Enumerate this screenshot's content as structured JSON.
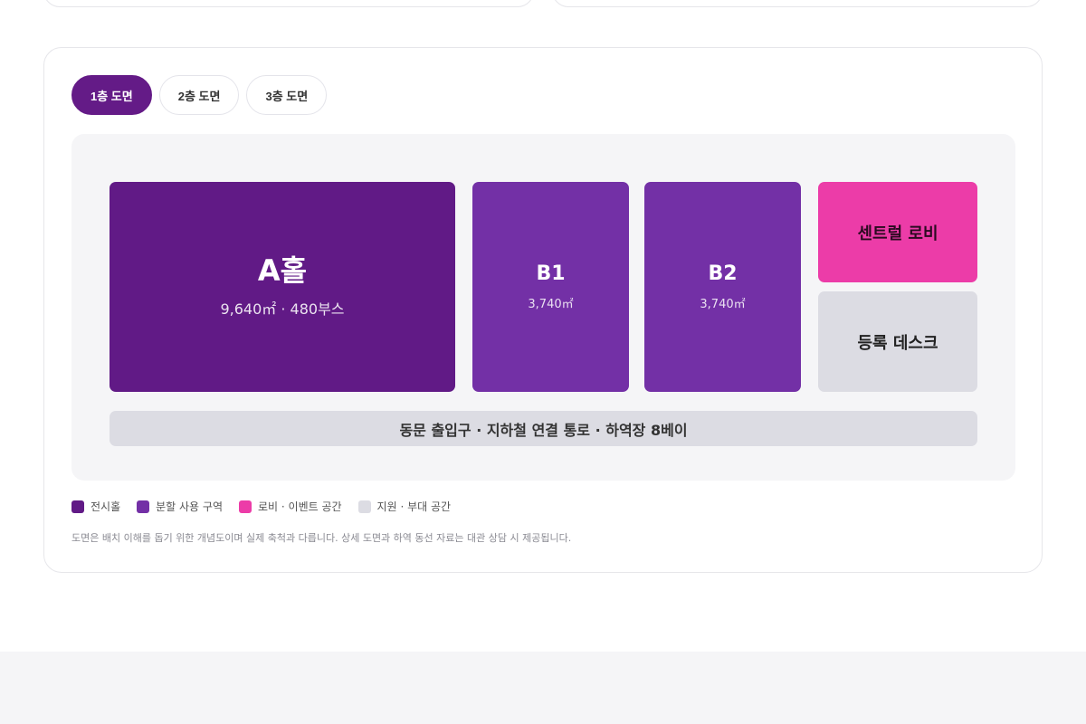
{
  "tabs": [
    {
      "label": "1층 도면",
      "active": true
    },
    {
      "label": "2층 도면",
      "active": false
    },
    {
      "label": "3층 도면",
      "active": false
    }
  ],
  "zones": {
    "a_hall": {
      "name": "A홀",
      "info": "9,640㎡ · 480부스"
    },
    "b1": {
      "name": "B1",
      "info": "3,740㎡"
    },
    "b2": {
      "name": "B2",
      "info": "3,740㎡"
    },
    "lobby": {
      "name": "센트럴 로비"
    },
    "desk": {
      "name": "등록 데스크"
    },
    "corridor": {
      "name": "동문 출입구 · 지하철 연결 통로 · 하역장 8베이"
    }
  },
  "legend": [
    {
      "label": "전시홀",
      "color": "#611a86"
    },
    {
      "label": "분할 사용 구역",
      "color": "#7330a6"
    },
    {
      "label": "로비 · 이벤트 공간",
      "color": "#ec3ca8"
    },
    {
      "label": "지원 · 부대 공간",
      "color": "#dcdce3"
    }
  ],
  "note": "도면은 배치 이해를 돕기 위한 개념도이며 실제 축척과 다릅니다. 상세 도면과 하역 동선 자료는 대관 상담 시 제공됩니다."
}
